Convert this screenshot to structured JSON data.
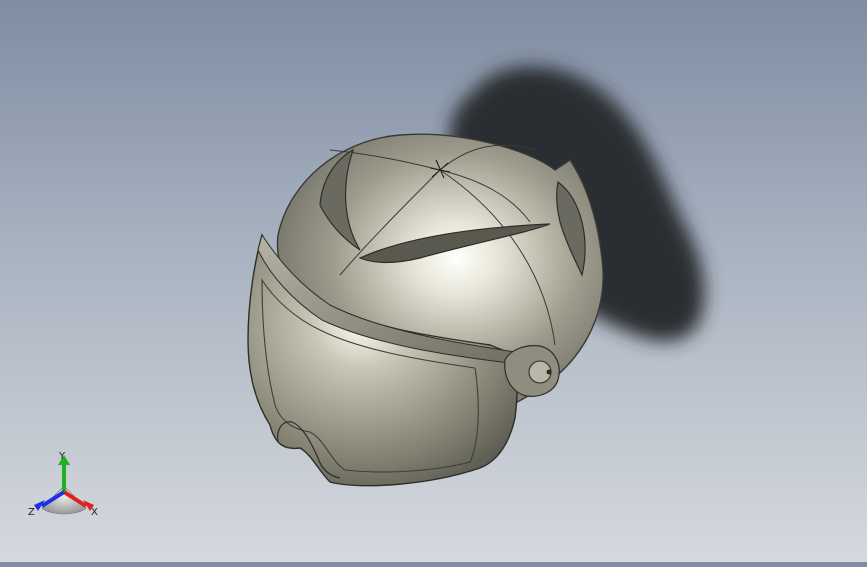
{
  "viewport": {
    "background_top": "#7f8da3",
    "background_bottom": "#d6d9de",
    "model": "helmet-with-visor",
    "shadow_color": "#2b2d31"
  },
  "triad": {
    "x_label": "X",
    "y_label": "Y",
    "z_label": "Z",
    "x_color": "#e02020",
    "y_color": "#20b020",
    "z_color": "#2030e0"
  }
}
